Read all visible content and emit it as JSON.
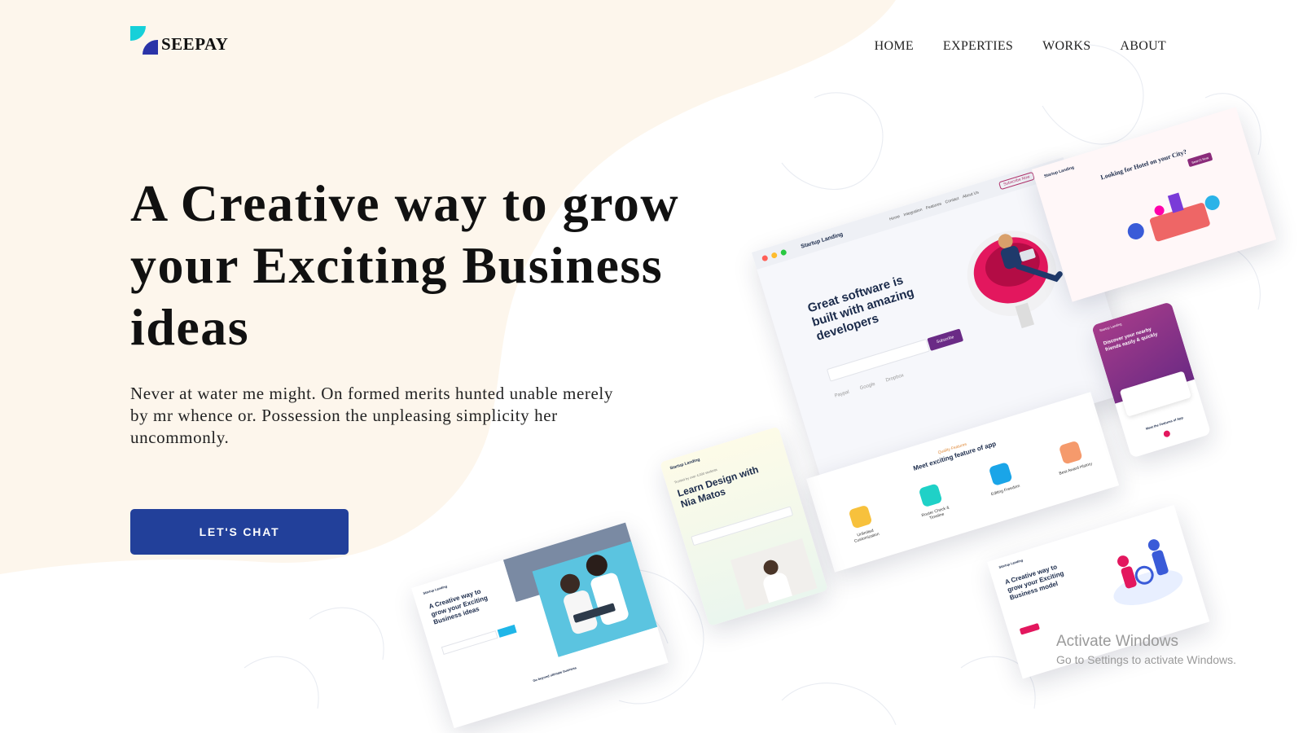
{
  "brand": {
    "name": "SEEPAY",
    "accent_cyan": "#16d0d9",
    "accent_indigo": "#2a33a8"
  },
  "nav": {
    "items": [
      "HOME",
      "EXPERTIES",
      "WORKS",
      "ABOUT"
    ]
  },
  "hero": {
    "title": "A Creative way to grow your Exciting Business ideas",
    "description": "Never at water me might. On formed merits hunted unable merely by mr whence or. Possession the unpleasing simplicity her uncommonly.",
    "cta_label": "LET'S CHAT",
    "cta_color": "#22409a"
  },
  "colors": {
    "blob": "#fdf6ec",
    "page": "#ffffff"
  },
  "mockups": {
    "main": {
      "logo": "Startup Landing",
      "nav": [
        "Home",
        "Integration",
        "Features",
        "Contact",
        "About Us"
      ],
      "signup": "Subscribe Now",
      "headline": "Great software is built with amazing developers",
      "cta": "Subscribe",
      "partners": [
        "Paypal",
        "Google",
        "Dropbox"
      ],
      "section_tag": "Quality Features",
      "section_title": "Meet exciting feature of app",
      "features": [
        "Unlimited Customization",
        "Router Check & Timeline",
        "Editing Freedom",
        "Best Award History"
      ]
    },
    "hotel": {
      "logo": "Startup Landing",
      "headline": "Looking for Hotel on your City?",
      "button": "Search Now"
    },
    "mobile": {
      "logo": "Startup Landing",
      "headline": "Discover your nearby friends easily & quickly",
      "footer": "Meet the Features of App"
    },
    "learn": {
      "logo": "Startup Landing",
      "badge": "Trusted by over 4,000 students",
      "headline": "Learn Design with Nia Matos"
    },
    "creative_left": {
      "logo": "Startup Landing",
      "headline": "A Creative way to grow your Exciting Business ideas",
      "footer": "Go beyond ultimate business"
    },
    "creative_right": {
      "logo": "Startup Landing",
      "headline": "A Creative way to grow your Exciting Business model"
    }
  },
  "watermark": {
    "line1": "Activate Windows",
    "line2": "Go to Settings to activate Windows."
  }
}
